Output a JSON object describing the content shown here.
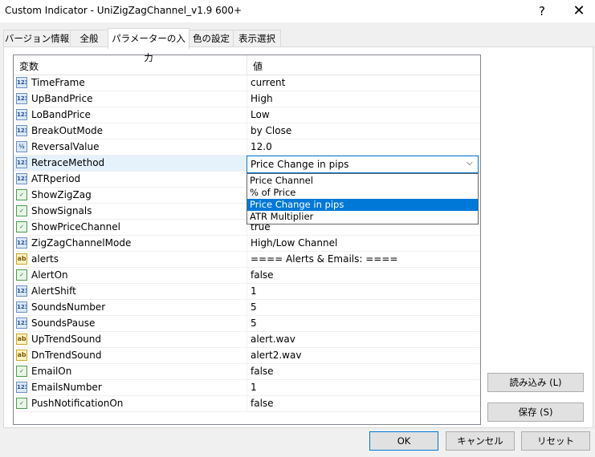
{
  "window": {
    "title": "Custom Indicator - UniZigZagChannel_v1.9 600+",
    "help_glyph": "?",
    "close_glyph": "✕"
  },
  "tabs": [
    {
      "label": "バージョン情報"
    },
    {
      "label": "全般"
    },
    {
      "label": "パラメーターの入力"
    },
    {
      "label": "色の設定"
    },
    {
      "label": "表示選択"
    }
  ],
  "grid": {
    "col_name": "変数",
    "col_value": "値",
    "rows": [
      {
        "icon": "123",
        "name": "TimeFrame",
        "value": "current"
      },
      {
        "icon": "123",
        "name": "UpBandPrice",
        "value": "High"
      },
      {
        "icon": "123",
        "name": "LoBandPrice",
        "value": "Low"
      },
      {
        "icon": "123",
        "name": "BreakOutMode",
        "value": "by Close"
      },
      {
        "icon": "½",
        "name": "ReversalValue",
        "value": "12.0"
      },
      {
        "icon": "123",
        "name": "RetraceMethod",
        "value": ""
      },
      {
        "icon": "123",
        "name": "ATRperiod",
        "value": ""
      },
      {
        "icon": "✓",
        "name": "ShowZigZag",
        "value": ""
      },
      {
        "icon": "✓",
        "name": "ShowSignals",
        "value": ""
      },
      {
        "icon": "✓",
        "name": "ShowPriceChannel",
        "value": "true"
      },
      {
        "icon": "123",
        "name": "ZigZagChannelMode",
        "value": "High/Low Channel"
      },
      {
        "icon": "ab",
        "name": "alerts",
        "value": "==== Alerts & Emails: ===="
      },
      {
        "icon": "✓",
        "name": "AlertOn",
        "value": "false"
      },
      {
        "icon": "123",
        "name": "AlertShift",
        "value": "1"
      },
      {
        "icon": "123",
        "name": "SoundsNumber",
        "value": "5"
      },
      {
        "icon": "123",
        "name": "SoundsPause",
        "value": "5"
      },
      {
        "icon": "ab",
        "name": "UpTrendSound",
        "value": "alert.wav"
      },
      {
        "icon": "ab",
        "name": "DnTrendSound",
        "value": "alert2.wav"
      },
      {
        "icon": "✓",
        "name": "EmailOn",
        "value": "false"
      },
      {
        "icon": "123",
        "name": "EmailsNumber",
        "value": "1"
      },
      {
        "icon": "✓",
        "name": "PushNotificationOn",
        "value": "false"
      }
    ]
  },
  "combo": {
    "selected": "Price Change in pips",
    "arrow_glyph": "⌵",
    "options": [
      "Price Channel",
      "% of Price",
      "Price Change in pips",
      "ATR Multiplier"
    ]
  },
  "side_buttons": {
    "load": "読み込み (L)",
    "save": "保存 (S)"
  },
  "footer_buttons": {
    "ok": "OK",
    "cancel": "キャンセル",
    "reset": "リセット"
  }
}
